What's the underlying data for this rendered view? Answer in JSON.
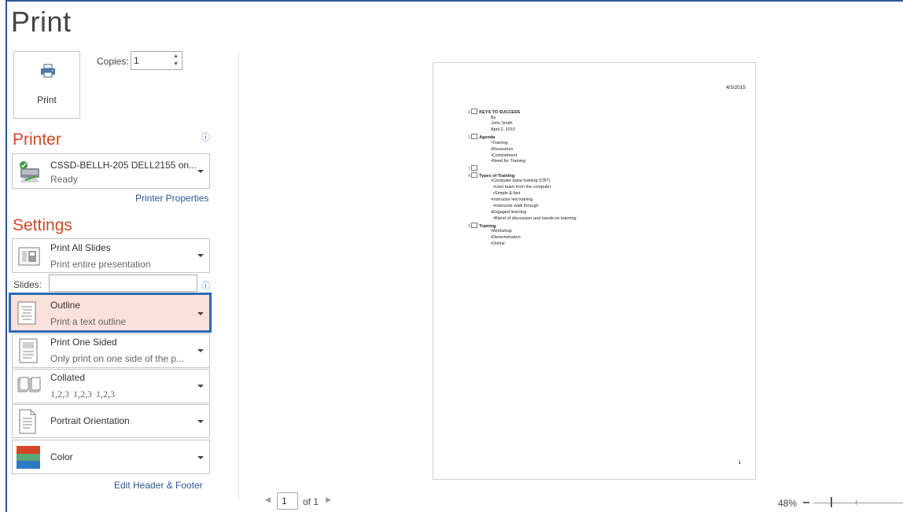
{
  "title": "Print",
  "print_button": {
    "label": "Print",
    "icon": "printer-icon"
  },
  "copies": {
    "label": "Copies:",
    "value": "1"
  },
  "printer": {
    "heading": "Printer",
    "name": "CSSD-BELLH-205 DELL2155 on...",
    "status": "Ready",
    "properties_link": "Printer Properties"
  },
  "settings": {
    "heading": "Settings",
    "slides_range": {
      "title": "Print All Slides",
      "subtitle": "Print entire presentation"
    },
    "slides_label": "Slides:",
    "slides_value": "",
    "layout": {
      "title": "Outline",
      "subtitle": "Print a text outline"
    },
    "sides": {
      "title": "Print One Sided",
      "subtitle": "Only print on one side of the p..."
    },
    "collation": {
      "title": "Collated",
      "subtitle": "1,2,3   1,2,3   1,2,3"
    },
    "orientation": {
      "title": "Portrait Orientation"
    },
    "color": {
      "title": "Color"
    },
    "header_footer_link": "Edit Header & Footer"
  },
  "preview": {
    "date": "4/3/2015",
    "page_number": "1",
    "outline": [
      {
        "num": "1",
        "text": "KEYS TO SUCCESS",
        "bold": true,
        "slide": true
      },
      {
        "text": "By"
      },
      {
        "text": "John Smith"
      },
      {
        "text": "April 2, 2015"
      },
      {
        "num": "2",
        "text": "Agenda",
        "bold": true,
        "slide": true
      },
      {
        "text": "•Training"
      },
      {
        "text": "•Resources"
      },
      {
        "text": "•Commitment"
      },
      {
        "text": "•Need for Training"
      },
      {
        "num": "3",
        "text": "",
        "slide": true
      },
      {
        "num": "4",
        "text": "Types of Training",
        "bold": true,
        "slide": true
      },
      {
        "text": "•Computer-base training (CBT)"
      },
      {
        "text": "•User learn from the computer"
      },
      {
        "text": "•Simple & fast"
      },
      {
        "text": "•Instructor led training"
      },
      {
        "text": "•Instructor walk through"
      },
      {
        "text": "•Engaged learning"
      },
      {
        "text": "•Blend of discussion and hands-on learning"
      },
      {
        "num": "5",
        "text": "Training",
        "bold": true,
        "slide": true
      },
      {
        "text": "•Workshop"
      },
      {
        "text": "•Demonstration"
      },
      {
        "text": "•Online"
      }
    ]
  },
  "navigation": {
    "page": "1",
    "of_label": "of 1"
  },
  "zoom": {
    "level": "48%"
  }
}
